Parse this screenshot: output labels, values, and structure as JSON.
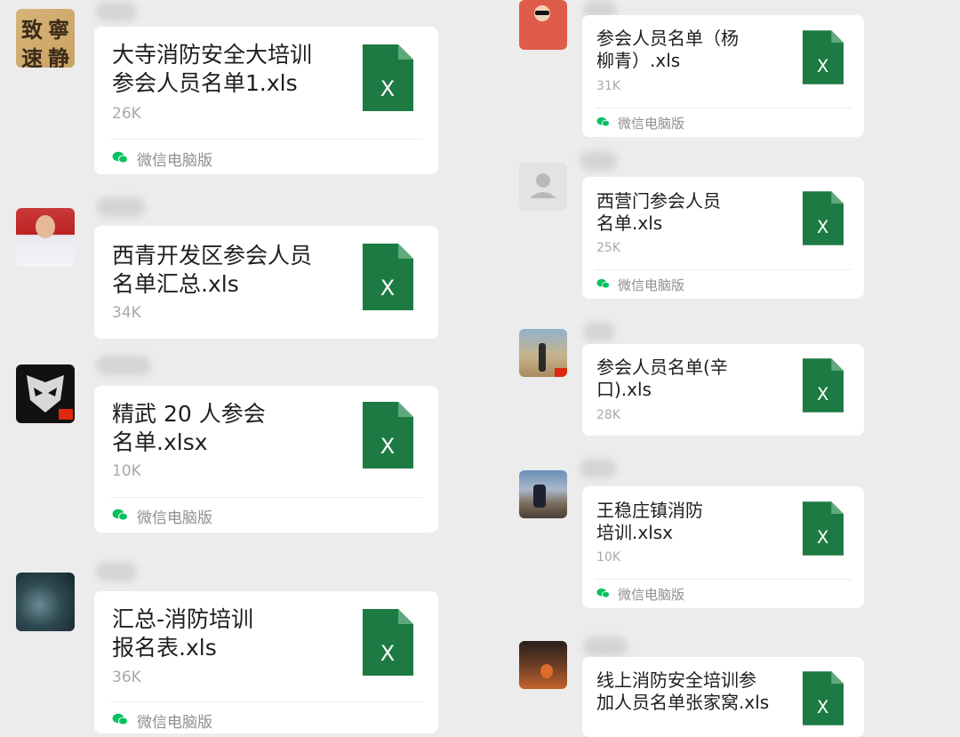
{
  "source_label": "微信电脑版",
  "left": [
    {
      "name": "大寺消防安全大培训\n参会人员名单1.xls",
      "size": "26K"
    },
    {
      "name": "西青开发区参会人员\n名单汇总.xls",
      "size": "34K"
    },
    {
      "name": "精武 20 人参会\n名单.xlsx",
      "size": "10K"
    },
    {
      "name": "汇总-消防培训\n报名表.xls",
      "size": "36K"
    }
  ],
  "right": [
    {
      "name": "参会人员名单（杨\n柳青）.xls",
      "size": "31K"
    },
    {
      "name": "西营门参会人员\n名单.xls",
      "size": "25K"
    },
    {
      "name": "参会人员名单(辛\n口).xls",
      "size": "28K"
    },
    {
      "name": "王稳庄镇消防\n培训.xlsx",
      "size": "10K"
    },
    {
      "name": "线上消防安全培训参\n加人员名单张家窝.xls",
      "size": ""
    }
  ],
  "avatar_text": {
    "calligraphy": [
      "致",
      "寧",
      "速",
      "静"
    ]
  },
  "icons": {
    "file": "excel-file-icon",
    "letter": "X",
    "source": "wechat-icon"
  },
  "colors": {
    "excel_green": "#1d7a43",
    "background": "#ececec",
    "bubble": "#ffffff",
    "wechat_green": "#07c160"
  }
}
